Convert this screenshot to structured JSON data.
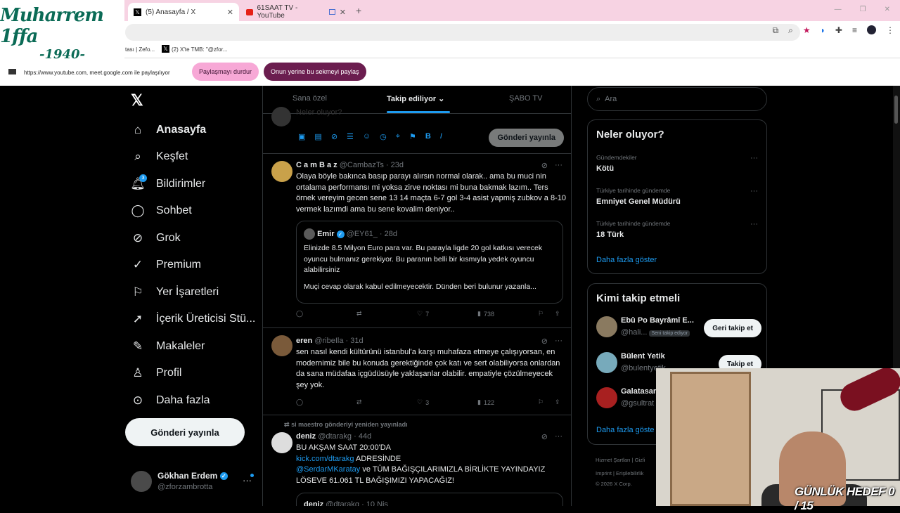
{
  "browser": {
    "tabs": [
      {
        "label": "(5) Anasayfa / X",
        "icon": "x-logo-icon"
      },
      {
        "label": "61SAAT TV - YouTube",
        "icon": "youtube-icon"
      }
    ],
    "bookmarks": [
      "tası | Zefo...",
      "(2) X'te TMB: \"@zfor..."
    ],
    "share_text": "https://www.youtube.com, meet.google.com ile paylaşılıyor",
    "stop_sharing": "Paylaşmayı durdur",
    "share_this_tab": "Onun yerine bu sekmeyi paylaş"
  },
  "overlay_logo": {
    "line1": "Muharrem 1ffa",
    "line2": "-1940-"
  },
  "nav": {
    "items": [
      "Anasayfa",
      "Keşfet",
      "Bildirimler",
      "Sohbet",
      "Grok",
      "Premium",
      "Yer İşaretleri",
      "İçerik Üreticisi Stü...",
      "Makaleler",
      "Profil",
      "Daha fazla"
    ],
    "notif_count": "3",
    "post_button": "Gönderi yayınla",
    "user_name": "Gökhan Erdem",
    "user_handle": "@zforzambrotta"
  },
  "feed": {
    "tabs": [
      "Sana özel",
      "Takip ediliyor",
      "ŞABO TV"
    ],
    "compose_button": "Gönderi yayınla",
    "composer_ghost": "Neler oluyor?",
    "tweets": [
      {
        "name": "C a m B a z",
        "handle": "@CambazTs",
        "time": "· 23d",
        "text": "Olaya böyle bakınca basıp parayı alırsın normal olarak.. ama bu muci nin ortalama performansı mi yoksa zirve noktası mi buna bakmak lazım.. Ters örnek vereyim gecen sene 13 14 maçta 6-7 gol 3-4 asist yapmiş zubkov a 8-10 vermek lazımdi ama bu sene kovalim deniyor..",
        "quote": {
          "name": "Emir",
          "handle": "@EY61_",
          "time": "· 28d",
          "text1": "Elinizde 8.5 Milyon Euro para var. Bu parayla ligde 20 gol katkısı verecek oyuncu bulmanız gerekiyor. Bu paranın belli bir kısmıyla yedek oyuncu alabilirsiniz",
          "text2": "Muçi cevap olarak kabul edilmeyecektir. Dünden beri bulunur yazanla..."
        },
        "likes": "7",
        "views": "738"
      },
      {
        "name": "eren",
        "handle": "@ribeIla",
        "time": "· 31d",
        "text": "sen nasıl kendi kültürünü istanbul'a karşı muhafaza etmeye çalışıyorsan, en modernimiz bile bu konuda gerektiğinde çok katı ve sert olabiliyorsa onlardan da sana müdafaa içgüdüsüyle yaklaşanlar olabilir. empatiyle çözülmeyecek şey yok.",
        "likes": "3",
        "views": "122"
      },
      {
        "repost_by": "si maestro gönderiyi yeniden yayınladı",
        "name": "deniz",
        "handle": "@dtarakg",
        "time": "· 44d",
        "line1": "BU AKŞAM SAAT 20:00'DA",
        "link1": "kick.com/dtarakg",
        "line2": " ADRESİNDE",
        "mention": "@SerdarMKaratay",
        "line3": " ve TÜM BAĞIŞÇILARIMIZLA BİRLİKTE YAYINDAYIZ",
        "line4": "LÖSEVE 61.061 TL BAĞIŞIMIZI YAPACAĞIZ!",
        "quote_name": "deniz",
        "quote_handle": "@dtarakg · 10 Nis"
      }
    ]
  },
  "sidebar": {
    "search_placeholder": "Ara",
    "trends_title": "Neler oluyor?",
    "trends": [
      {
        "meta": "Gündemdekiler",
        "name": "Kötü"
      },
      {
        "meta": "Türkiye tarihinde gündemde",
        "name": "Emniyet Genel Müdürü"
      },
      {
        "meta": "Türkiye tarihinde gündemde",
        "name": "18 Türk"
      }
    ],
    "show_more": "Daha fazla göster",
    "who_title": "Kimi takip etmeli",
    "who": [
      {
        "name": "Ebû Po Bayrâmî E...",
        "handle": "@hali...",
        "follows_you": "Seni takip ediyor",
        "button": "Geri takip et"
      },
      {
        "name": "Bülent Yetik",
        "handle": "@bulentyetik",
        "button": "Takip et"
      },
      {
        "name": "Galatasaray",
        "handle": "@gsultrat"
      }
    ],
    "who_more": "Daha fazla göste",
    "footer1": "Hizmet Şartları  |  Gizli",
    "footer2": "Imprint  |  Erişilebilirlik",
    "footer3": "© 2026 X Corp."
  },
  "stream_goal": "GÜNLÜK HEDEF 0 / 15",
  "colors": {
    "accent": "#1d9bf0",
    "bg": "#000000",
    "tabbar": "#f7d3e3"
  }
}
